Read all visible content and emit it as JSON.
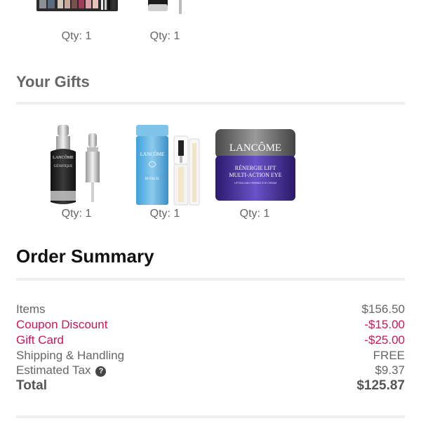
{
  "top_items": [
    {
      "name": "makeup palette",
      "qty": "Qty: 1"
    },
    {
      "name": "serum bottle",
      "qty": "Qty: 1"
    }
  ],
  "gifts": {
    "title": "Your Gifts",
    "items": [
      {
        "name": "Advanced Génifique serum",
        "brand": "LANCÔME",
        "product": "GÉNIFIQUE",
        "qty": "Qty: 1"
      },
      {
        "name": "Bi-Facil makeup remover and mascara",
        "brand": "LANCÔME",
        "product": "BI-FACIL",
        "qty": "Qty: 1"
      },
      {
        "name": "Rénergie Lift Multi-Action Eye cream",
        "brand": "LANCÔME",
        "line1": "RÉNERGIE LIFT",
        "line2": "MULTI-ACTION EYE",
        "line3": "LIFTING AND FIRMING EYE CREAM",
        "qty": "Qty: 1"
      }
    ]
  },
  "summary": {
    "title": "Order Summary",
    "items_label": "Items",
    "items_value": "$156.50",
    "coupon_label": "Coupon Discount",
    "coupon_value": "-$15.00",
    "giftcard_label": "Gift Card",
    "giftcard_value": "-$25.00",
    "shipping_label": "Shipping & Handling",
    "shipping_value": "FREE",
    "tax_label": "Estimated Tax",
    "tax_help": "?",
    "tax_value": "$9.37",
    "total_label": "Total",
    "total_value": "$125.87"
  },
  "colors": {
    "accent": "#d0145a",
    "text_muted": "#666666",
    "heading_dark": "#111111",
    "divider": "#efefef"
  },
  "icons": [
    "help-icon"
  ]
}
